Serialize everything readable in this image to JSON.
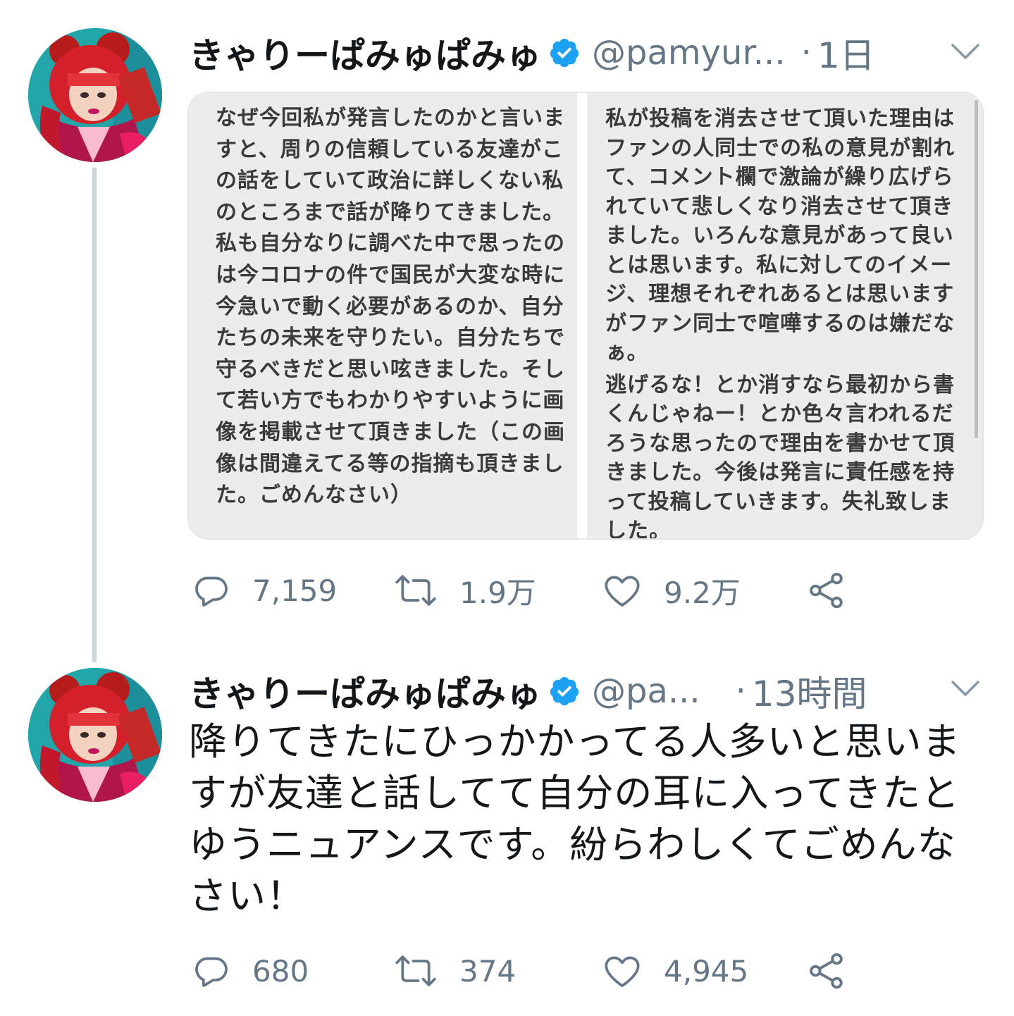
{
  "tweets": [
    {
      "display_name": "きゃりーぱみゅぱみゅ",
      "handle": "@pamyur...",
      "separator": "·",
      "time": "1日",
      "images": {
        "left_text": "なぜ今回私が発言したのかと言いますと、周りの信頼している友達がこの話をしていて政治に詳しくない私のところまで話が降りてきました。私も自分なりに調べた中で思ったのは今コロナの件で国民が大変な時に今急いで動く必要があるのか、自分たちの未来を守りたい。自分たちで守るべきだと思い呟きました。そして若い方でもわかりやすいように画像を掲載させて頂きました（この画像は間違えてる等の指摘も頂きました。ごめんなさい）",
        "right_text_1": "私が投稿を消去させて頂いた理由はファンの人同士での私の意見が割れて、コメント欄で激論が繰り広げられていて悲しくなり消去させて頂きました。いろんな意見があって良いとは思います。私に対してのイメージ、理想それぞれあるとは思いますがファン同士で喧嘩するのは嫌だなぁ。",
        "right_text_2": "逃げるな！とか消すなら最初から書くんじゃねー！とか色々言われるだろうな思ったので理由を書かせて頂きました。今後は発言に責任感を持って投稿していきます。失礼致しました。"
      },
      "actions": {
        "reply_count": "7,159",
        "retweet_count": "1.9万",
        "like_count": "9.2万"
      }
    },
    {
      "display_name": "きゃりーぱみゅぱみゅ",
      "handle": "@pa...",
      "separator": "·",
      "time": "13時間",
      "text": "降りてきたにひっかかってる人多いと思いますが友達と話してて自分の耳に入ってきたとゆうニュアンスです。紛らわしくてごめんなさい！",
      "actions": {
        "reply_count": "680",
        "retweet_count": "374",
        "like_count": "4,945"
      }
    }
  ],
  "colors": {
    "verified": "#1da1f2",
    "secondary_text": "#657786",
    "thread_line": "#ccd6dd",
    "image_background": "#ececec"
  },
  "icons": [
    "verified-badge-icon",
    "chevron-down-icon",
    "reply-icon",
    "retweet-icon",
    "like-icon",
    "share-icon"
  ]
}
